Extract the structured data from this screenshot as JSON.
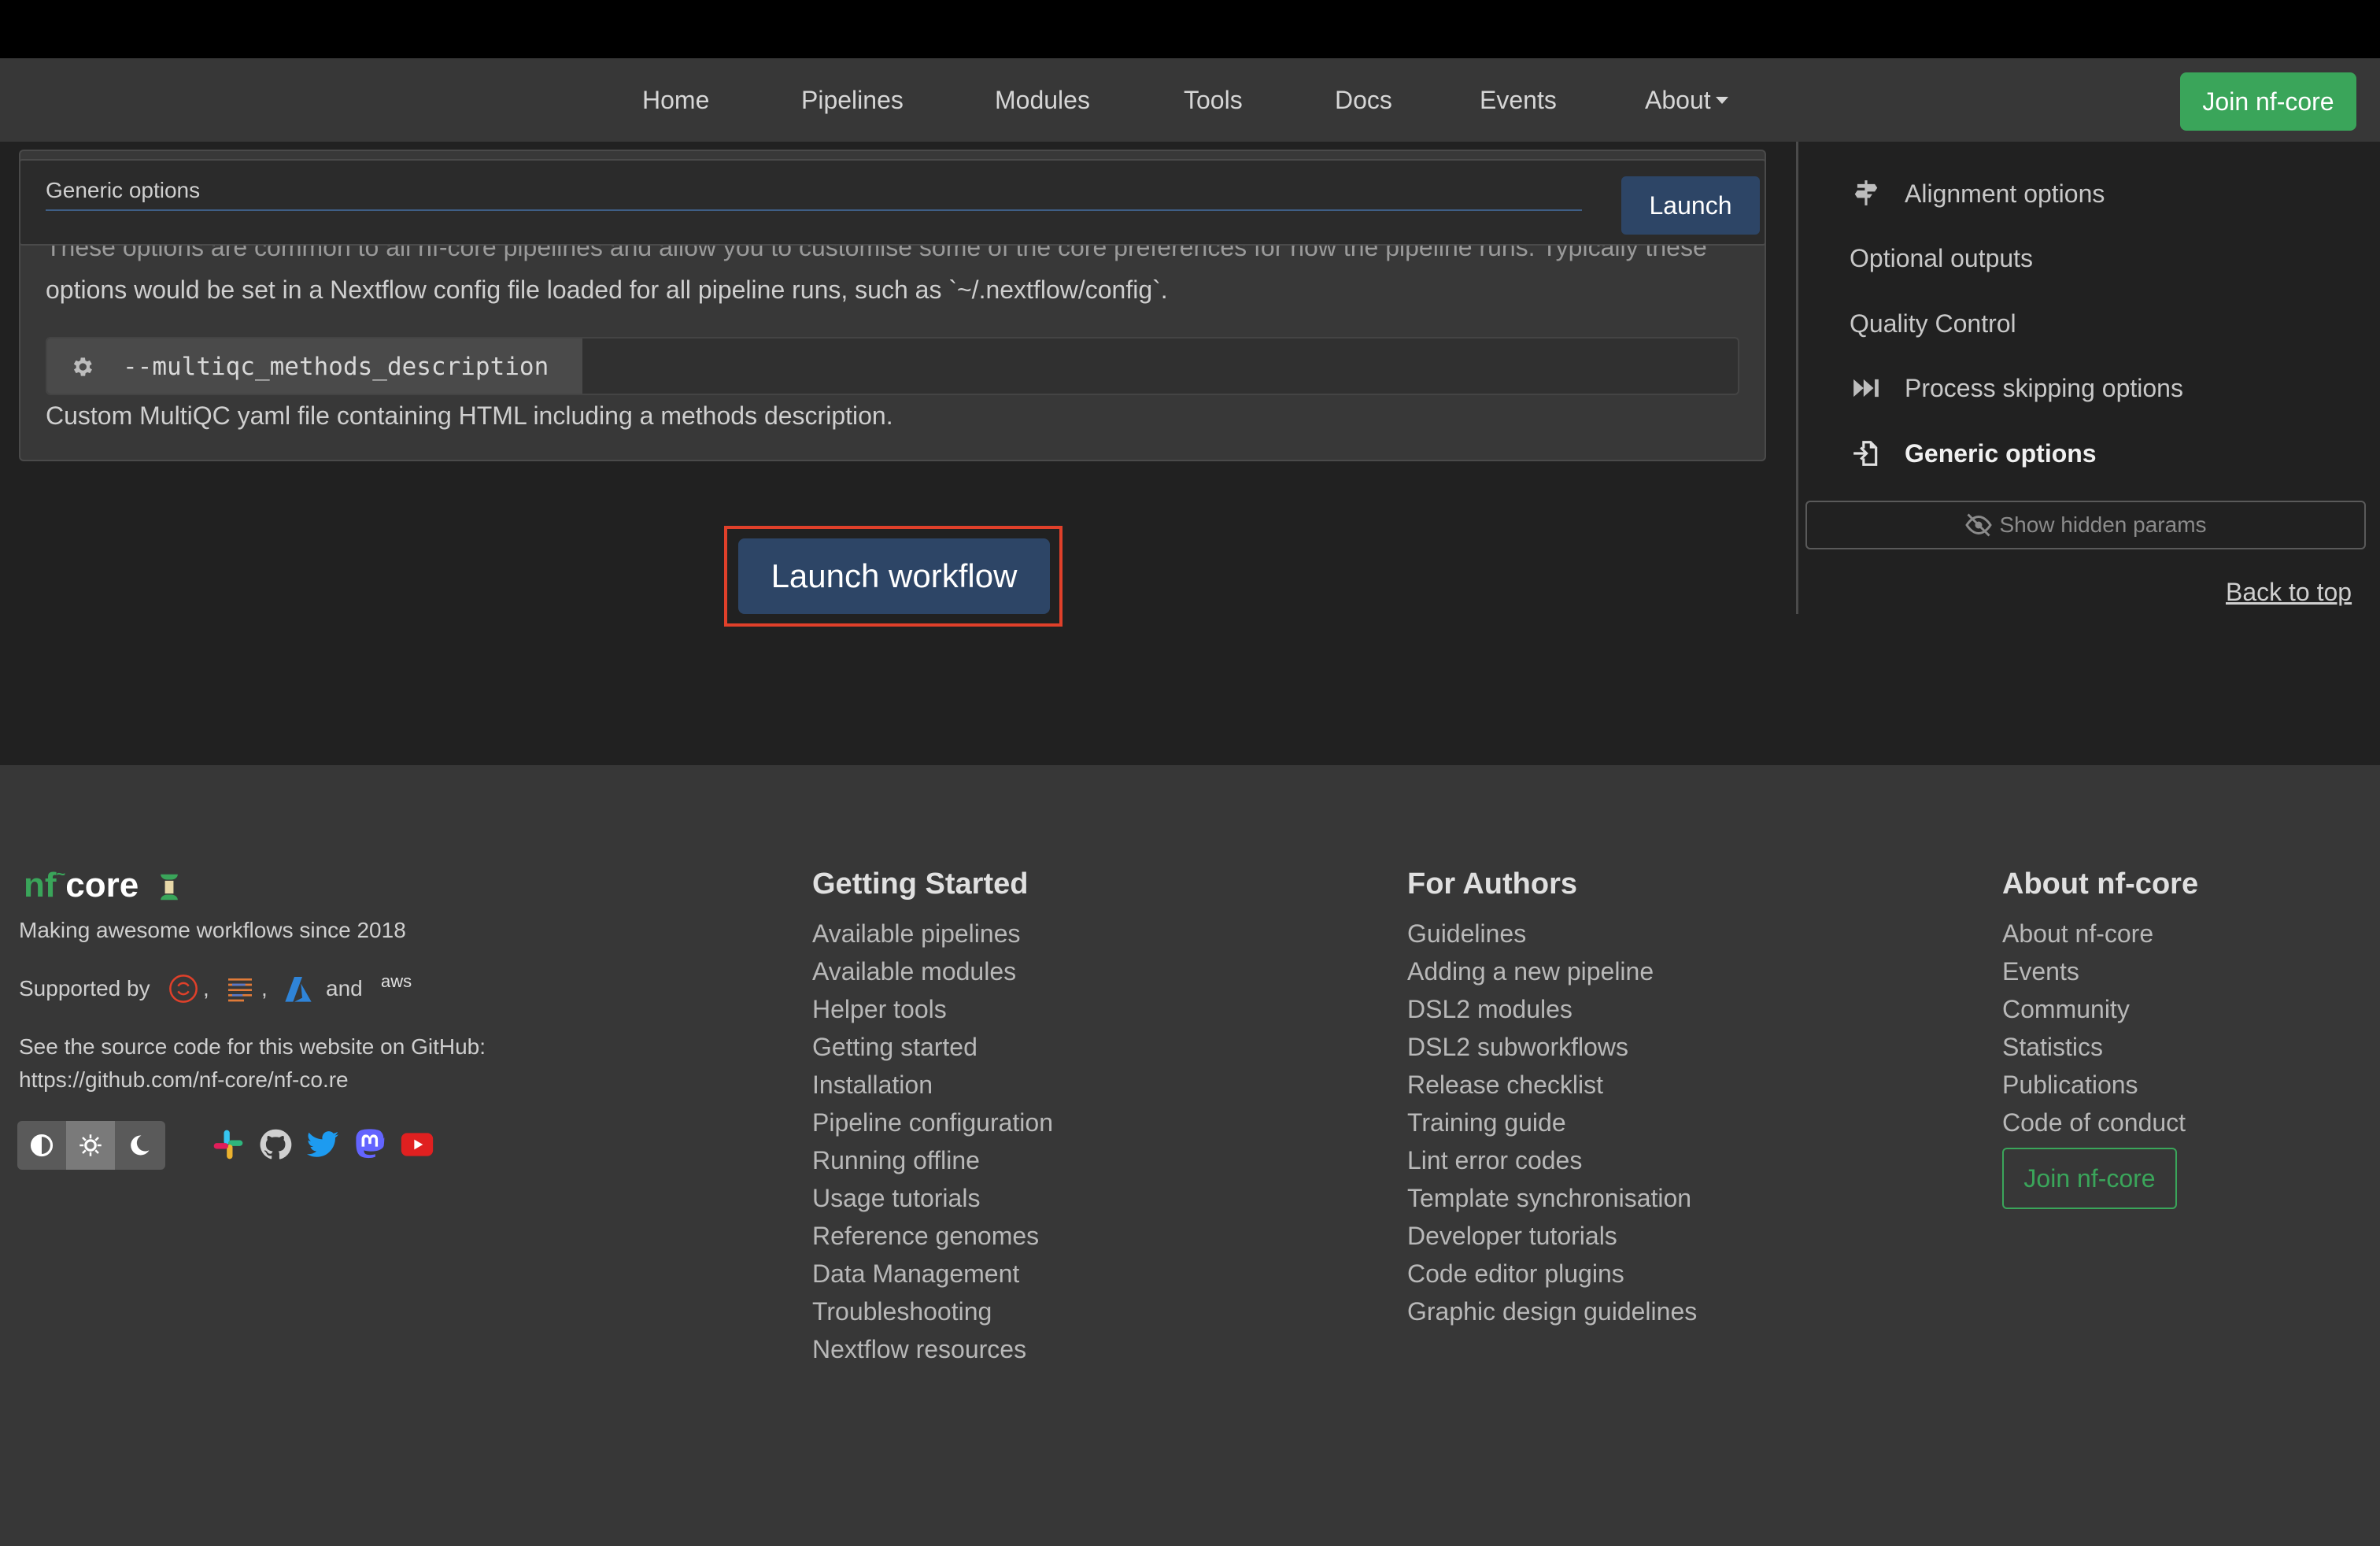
{
  "nav": {
    "items": [
      "Home",
      "Pipelines",
      "Modules",
      "Tools",
      "Docs",
      "Events",
      "About"
    ],
    "join_label": "Join nf-core"
  },
  "section": {
    "header_label": "Generic options",
    "launch_label": "Launch",
    "description_line1": "These options are common to all nf-core pipelines and allow you to customise some of the core preferences for how the pipeline runs. Typically these",
    "description_line2": "options would be set in a Nextflow config file loaded for all pipeline runs, such as `~/.nextflow/config`.",
    "param_name": "--multiqc_methods_description",
    "param_help": "Custom MultiQC yaml file containing HTML including a methods description."
  },
  "launch_workflow_label": "Launch workflow",
  "sidebar": {
    "items": [
      {
        "label": "Alignment options",
        "icon": "signpost-icon"
      },
      {
        "label": "Optional outputs",
        "icon": ""
      },
      {
        "label": "Quality Control",
        "icon": ""
      },
      {
        "label": "Process skipping options",
        "icon": "fast-forward-icon"
      },
      {
        "label": "Generic options",
        "icon": "file-import-icon"
      }
    ],
    "show_hidden_label": "Show hidden params",
    "back_to_top_label": "Back to top"
  },
  "footer": {
    "logo_nf": "nf",
    "logo_core": "core",
    "tagline": "Making awesome workflows since 2018",
    "supported_by": "Supported by",
    "and": "and",
    "source_line1": "See the source code for this website on GitHub:",
    "source_line2": "https://github.com/nf-core/nf-co.re",
    "getting_started": {
      "title": "Getting Started",
      "links": [
        "Available pipelines",
        "Available modules",
        "Helper tools",
        "Getting started",
        "Installation",
        "Pipeline configuration",
        "Running offline",
        "Usage tutorials",
        "Reference genomes",
        "Data Management",
        "Troubleshooting",
        "Nextflow resources"
      ]
    },
    "for_authors": {
      "title": "For Authors",
      "links": [
        "Guidelines",
        "Adding a new pipeline",
        "DSL2 modules",
        "DSL2 subworkflows",
        "Release checklist",
        "Training guide",
        "Lint error codes",
        "Template synchronisation",
        "Developer tutorials",
        "Code editor plugins",
        "Graphic design guidelines"
      ]
    },
    "about": {
      "title": "About nf-core",
      "links": [
        "About nf-core",
        "Events",
        "Community",
        "Statistics",
        "Publications",
        "Code of conduct"
      ],
      "join_label": "Join nf-core"
    },
    "aws_text": "aws"
  },
  "colors": {
    "accent_green": "#3aa55a",
    "button_blue": "#2d4566",
    "highlight_red": "#e0402a"
  }
}
